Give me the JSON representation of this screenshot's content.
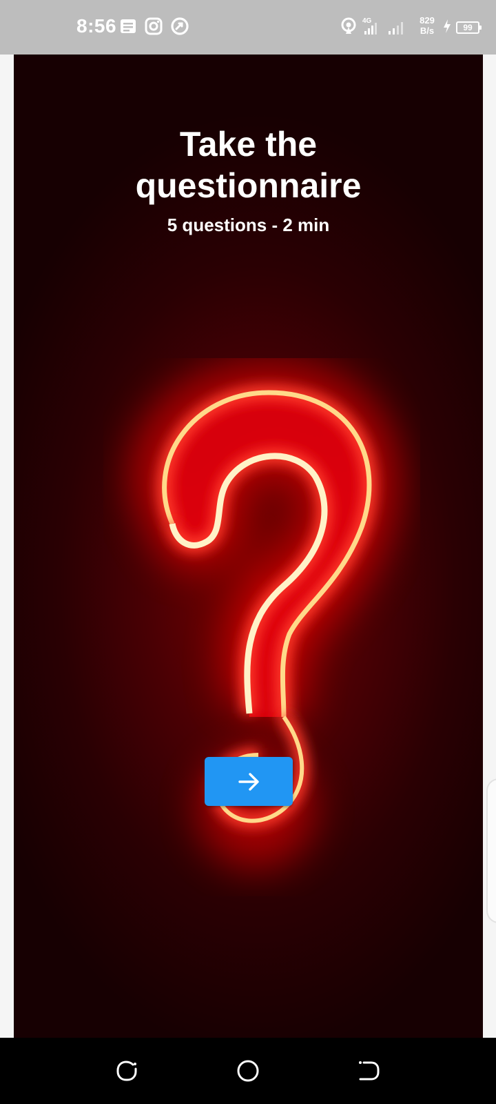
{
  "status_bar": {
    "time": "8:56",
    "net_speed_value": "829",
    "net_speed_unit": "B/s",
    "network_type": "4G",
    "battery_level": "99",
    "icons": [
      "notes-icon",
      "instagram-icon",
      "app-notification-icon",
      "hotspot-icon",
      "signal-4g-icon",
      "signal-icon",
      "charging-icon",
      "battery-icon"
    ]
  },
  "screen": {
    "title_line1": "Take the",
    "title_line2": "questionnaire",
    "subtitle": "5 questions - 2 min",
    "background_art": "neon-question-mark-icon",
    "next_button_icon": "arrow-right-icon"
  },
  "nav_bar": {
    "icons": [
      "recent-apps-icon",
      "home-icon",
      "back-icon"
    ]
  },
  "colors": {
    "status_bar_bg": "#bdbdbd",
    "accent_button": "#2196f3",
    "neon_red": "#ff1a1a",
    "neon_core": "#ffe9a0",
    "background_dark": "#1a0003"
  }
}
